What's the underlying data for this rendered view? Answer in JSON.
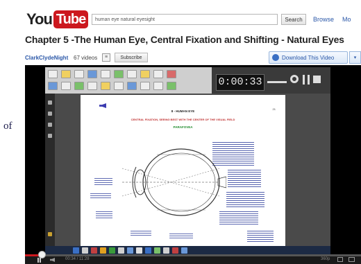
{
  "outside_text": "of",
  "header": {
    "logo_you": "You",
    "logo_tube": "Tube",
    "search_value": "human eye natural eyesight",
    "search_button": "Search",
    "browse_link": "Browse",
    "more_link": "Mo"
  },
  "video": {
    "title": "Chapter 5 -The Human Eye, Central Fixation and Shifting - Natural Eyes",
    "channel": "ClarkClydeNight",
    "video_count": "67 videos",
    "subscribe_label": "Subscribe",
    "download_label": "Download This Video"
  },
  "player": {
    "timer": "0:00:33",
    "doc_title": "8 - HUMAN EYE",
    "doc_subtitle": "CENTRAL FIXATION, SEEING BEST WITH THE CENTER OF THE VISUAL FIELD",
    "doc_green_heading": "PARAFOVEA",
    "page_number": "21",
    "time_display": "00:34 / 11:28",
    "quality": "360p",
    "progress": 0.05
  },
  "colors": {
    "brand_red": "#cc181e",
    "link_blue": "#2a57a8"
  }
}
